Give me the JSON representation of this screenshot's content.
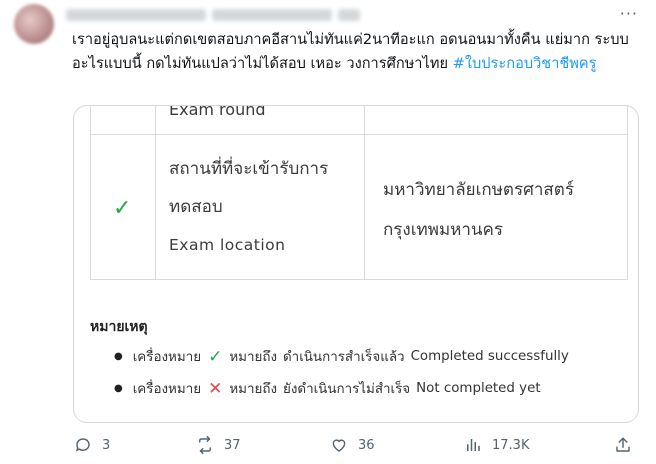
{
  "tweet": {
    "body_text": "เราอยู่อุบลนะแต่กดเขตสอบภาคอีสานไม่ทันแค่2นาทีอะแก อดนอนมาทั้งคืน แย่มาก ระบบอะไรแบบนี้ กดไม่ทันแปลว่าไม่ได้สอบ เหอะ วงการศึกษาไทย",
    "hashtag": "#ใบประกอบวิชาชีพครู"
  },
  "media": {
    "exam_round": "Exam round",
    "row_label_th_1": "สถานที่ที่จะเข้ารับการ",
    "row_label_th_2": "ทดสอบ",
    "row_label_en": "Exam location",
    "row_value_1": "มหาวิทยาลัยเกษตรศาสตร์",
    "row_value_2": "กรุงเทพมหานคร",
    "note_title": "หมายเหตุ",
    "note_1": {
      "prefix": "เครื่องหมาย",
      "symbol": "✓",
      "meaning": "หมายถึง",
      "th": "ดำเนินการสำเร็จแล้ว",
      "en": "Completed successfully"
    },
    "note_2": {
      "prefix": "เครื่องหมาย",
      "symbol": "✕",
      "meaning": "หมายถึง",
      "th": "ยังดำเนินการไม่สำเร็จ",
      "en": "Not completed yet"
    },
    "check_symbol": "✓"
  },
  "actions": {
    "replies": "3",
    "reposts": "37",
    "likes": "36",
    "views": "17.3K"
  },
  "header": {
    "more_symbol": "···"
  },
  "colors": {
    "accent": "#1d9bf0",
    "check": "#27a845",
    "cross": "#e5484d",
    "muted": "#536471"
  }
}
